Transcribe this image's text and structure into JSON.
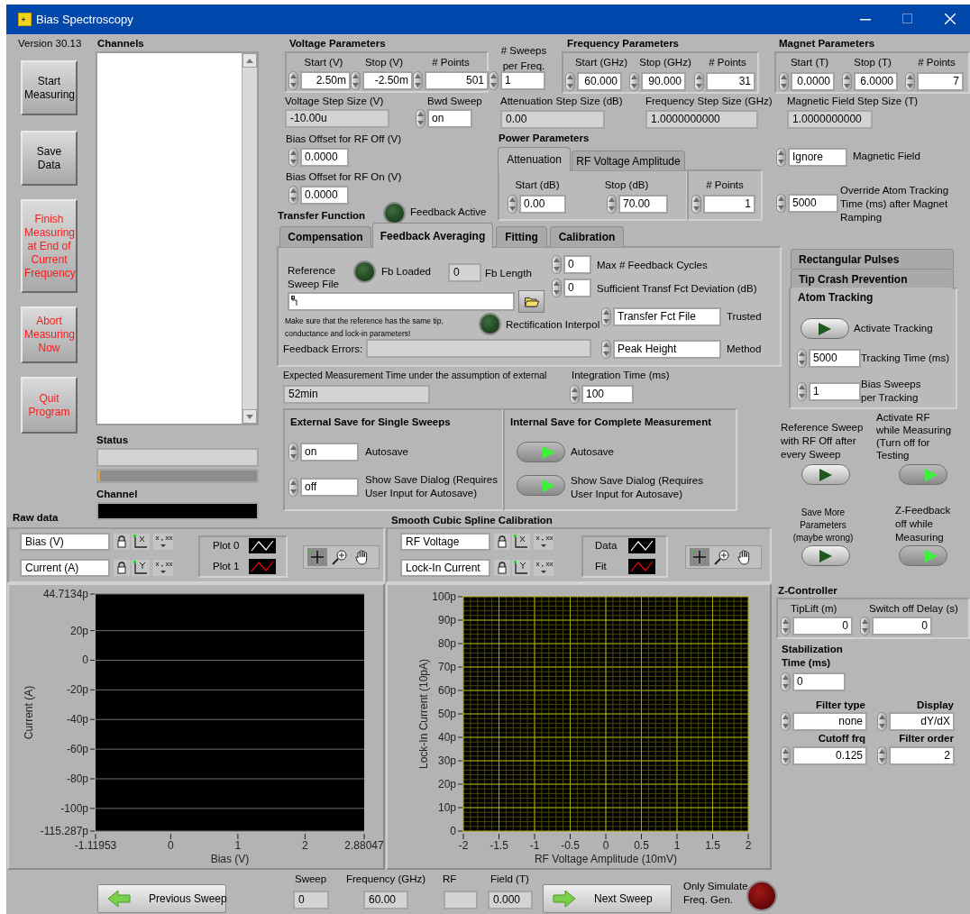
{
  "window": {
    "title": "Bias Spectroscopy"
  },
  "version": "Version 30.13",
  "buttons": [
    {
      "label": "Start Measuring",
      "kind": "normal"
    },
    {
      "label": "Save Data",
      "kind": "normal"
    },
    {
      "label": "Finish Measuring at End of Current Frequency",
      "kind": "alert"
    },
    {
      "label": "Abort Measuring Now",
      "kind": "alert"
    },
    {
      "label": "Quit Program",
      "kind": "alert"
    }
  ],
  "channels": {
    "label": "Channels"
  },
  "status": {
    "label": "Status",
    "level": 0.01
  },
  "channel": {
    "label": "Channel"
  },
  "voltage": {
    "title": "Voltage Parameters",
    "start": {
      "label": "Start (V)",
      "value": "2.50m"
    },
    "stop": {
      "label": "Stop (V)",
      "value": "-2.50m"
    },
    "points": {
      "label": "# Points",
      "value": "501"
    },
    "step": {
      "label": "Voltage Step Size (V)",
      "value": "-10.00u"
    },
    "bwd": {
      "label": "Bwd Sweep",
      "value": "on"
    },
    "offset_off": {
      "label": "Bias Offset for RF Off (V)",
      "value": "0.0000"
    },
    "offset_on": {
      "label": "Bias Offset for RF On (V)",
      "value": "0.0000"
    }
  },
  "sweeps": {
    "label": "# Sweeps per Freq.",
    "value": "1"
  },
  "frequency": {
    "title": "Frequency Parameters",
    "start": {
      "label": "Start (GHz)",
      "value": "60.000"
    },
    "stop": {
      "label": "Stop (GHz)",
      "value": "90.000"
    },
    "points": {
      "label": "# Points",
      "value": "31"
    },
    "step": {
      "label": "Frequency Step Size (GHz)",
      "value": "1.0000000000"
    }
  },
  "attenuation_step": {
    "label": "Attenuation Step Size (dB)",
    "value": "0.00"
  },
  "magnet": {
    "title": "Magnet Parameters",
    "start": {
      "label": "Start (T)",
      "value": "0.0000"
    },
    "stop": {
      "label": "Stop (T)",
      "value": "6.0000"
    },
    "points": {
      "label": "# Points",
      "value": "7"
    },
    "step": {
      "label": "Magnetic Field Step Size (T)",
      "value": "1.0000000000"
    }
  },
  "power": {
    "title": "Power Parameters",
    "tabs": [
      {
        "label": "Attenuation",
        "selected": true
      },
      {
        "label": "RF Voltage Amplitude",
        "selected": false
      }
    ],
    "start": {
      "label": "Start (dB)",
      "value": "0.00"
    },
    "stop": {
      "label": "Stop (dB)",
      "value": "70.00"
    },
    "points": {
      "label": "# Points",
      "value": "1"
    }
  },
  "magnetic_field": {
    "label": "Magnetic Field",
    "value": "Ignore"
  },
  "override": {
    "label": "Override Atom Tracking Time (ms) after Magnet Ramping",
    "value": "5000"
  },
  "transfer": {
    "title": "Transfer Function",
    "feedback_active": {
      "label": "Feedback Active",
      "on": false
    },
    "tabs": [
      {
        "label": "Compensation",
        "selected": false
      },
      {
        "label": "Feedback Averaging",
        "selected": true
      },
      {
        "label": "Fitting",
        "selected": false
      },
      {
        "label": "Calibration",
        "selected": false
      }
    ],
    "reference": "Reference Sweep File",
    "fb_loaded": {
      "label": "Fb Loaded",
      "on": false
    },
    "fb_length": {
      "label": "Fb Length",
      "value": "0"
    },
    "note": "Make sure that the reference has the same tip, conductance and lock-in parameters!",
    "rectification": {
      "label": "Rectification Interpol",
      "on": false
    },
    "errors": {
      "label": "Feedback Errors:"
    },
    "max_cycles": {
      "label": "Max # Feedback Cycles",
      "value": "0"
    },
    "deviation": {
      "label": "Sufficient Transf Fct Deviation (dB)",
      "value": "0"
    },
    "trusted": {
      "label": "Trusted",
      "value": "Transfer Fct File"
    },
    "method": {
      "label": "Method",
      "value": "Peak Height"
    }
  },
  "expected_time": {
    "label": "Expected Measurement Time under the assumption of external",
    "value": "52min"
  },
  "integration_time": {
    "label": "Integration Time (ms)",
    "value": "100"
  },
  "external_save": {
    "title": "External Save for Single Sweeps",
    "autosave": {
      "label": "Autosave",
      "value": "on"
    },
    "dialog": {
      "label": "Show Save Dialog (Requires User Input for Autosave)",
      "value": "off"
    }
  },
  "internal_save": {
    "title": "Internal Save for Complete Measurement",
    "autosave": {
      "label": "Autosave",
      "on": true
    },
    "dialog": {
      "label": "Show Save Dialog (Requires User Input for Autosave)",
      "on": true
    }
  },
  "side_tabs": [
    {
      "label": "Rectangular Pulses",
      "selected": false
    },
    {
      "label": "Tip Crash Prevention",
      "selected": false
    },
    {
      "label": "Atom Tracking",
      "selected": true
    }
  ],
  "atom_tracking": {
    "activate": {
      "label": "Activate Tracking",
      "on": false
    },
    "time": {
      "label": "Tracking Time (ms)",
      "value": "5000"
    },
    "sweeps": {
      "label": "Bias Sweeps per Tracking",
      "value": "1"
    }
  },
  "switches": [
    {
      "label": "Reference Sweep with RF Off after every Sweep",
      "on": false
    },
    {
      "label": "Activate RF while Measuring (Turn off for Testing",
      "on": true
    },
    {
      "label": "Save More Parameters (maybe wrong)",
      "on": false
    },
    {
      "label": "Z-Feedback off while Measuring",
      "on": true
    }
  ],
  "z_controller": {
    "title": "Z-Controller",
    "tiplift": {
      "label": "TipLift (m)",
      "value": "0"
    },
    "delay": {
      "label": "Switch off Delay (s)",
      "value": "0"
    }
  },
  "stabilization": {
    "label": "Stabilization Time (ms)",
    "value": "0"
  },
  "filter": [
    {
      "label": "Filter type",
      "value": "none"
    },
    {
      "label": "Display",
      "value": "dY/dX"
    },
    {
      "label": "Cutoff frq",
      "value": "0.125"
    },
    {
      "label": "Filter order",
      "value": "2"
    }
  ],
  "raw_data": {
    "title": "Raw data",
    "x_name": "Bias (V)",
    "y_name": "Current (A)",
    "plots": [
      {
        "name": "Plot 0",
        "color": "#ffffff"
      },
      {
        "name": "Plot 1",
        "color": "#ff0000"
      }
    ],
    "chart_data": {
      "type": "line",
      "grid": true,
      "xlabel": "Bias (V)",
      "ylabel": "Current (A)",
      "xlim": [
        -1.11953,
        2.88047
      ],
      "ylim": [
        -115.287,
        44.7134
      ],
      "xticks": [
        {
          "value": -1.11953,
          "label": "-1.11953"
        },
        0,
        1,
        2,
        {
          "value": 2.88047,
          "label": "2.88047"
        }
      ],
      "yticks": [
        {
          "value": 44.7134,
          "label": "44.7134p"
        },
        {
          "value": 20,
          "label": "20p"
        },
        0,
        {
          "value": -20,
          "label": "-20p"
        },
        {
          "value": -40,
          "label": "-40p"
        },
        {
          "value": -60,
          "label": "-60p"
        },
        {
          "value": -80,
          "label": "-80p"
        },
        {
          "value": -100,
          "label": "-100p"
        },
        {
          "value": -115.287,
          "label": "-115.287p"
        }
      ]
    }
  },
  "calibration": {
    "title": "Smooth Cubic Spline Calibration",
    "x_name": "RF Voltage",
    "y_name": "Lock-In Current",
    "plots": [
      {
        "name": "Data",
        "color": "#ffffff"
      },
      {
        "name": "Fit",
        "color": "#ff0000"
      }
    ],
    "chart_data": {
      "type": "line",
      "grid": true,
      "xlabel": "RF Voltage Amplitude (10mV)",
      "ylabel": "Lock-In Current (10pA)",
      "xlim": [
        -2,
        2
      ],
      "ylim": [
        0,
        100
      ],
      "xticks": [
        -2,
        -1.5,
        -1,
        -0.5,
        0,
        0.5,
        1,
        1.5,
        2
      ],
      "yticks": [
        0,
        {
          "value": 10,
          "label": "10p"
        },
        {
          "value": 20,
          "label": "20p"
        },
        {
          "value": 30,
          "label": "30p"
        },
        {
          "value": 40,
          "label": "40p"
        },
        {
          "value": 50,
          "label": "50p"
        },
        {
          "value": 60,
          "label": "60p"
        },
        {
          "value": 70,
          "label": "70p"
        },
        {
          "value": 80,
          "label": "80p"
        },
        {
          "value": 90,
          "label": "90p"
        },
        {
          "value": 100,
          "label": "100p"
        }
      ]
    }
  },
  "bottom": {
    "previous": "Previous Sweep",
    "next": "Next Sweep",
    "sweep": {
      "label": "Sweep",
      "value": "0"
    },
    "frequency": {
      "label": "Frequency (GHz)",
      "value": "60.00"
    },
    "rf": {
      "label": "RF"
    },
    "field": {
      "label": "Field (T)",
      "value": "0.000"
    },
    "simulate": {
      "label": "Only Simulate Freq. Gen.",
      "on": false
    }
  }
}
